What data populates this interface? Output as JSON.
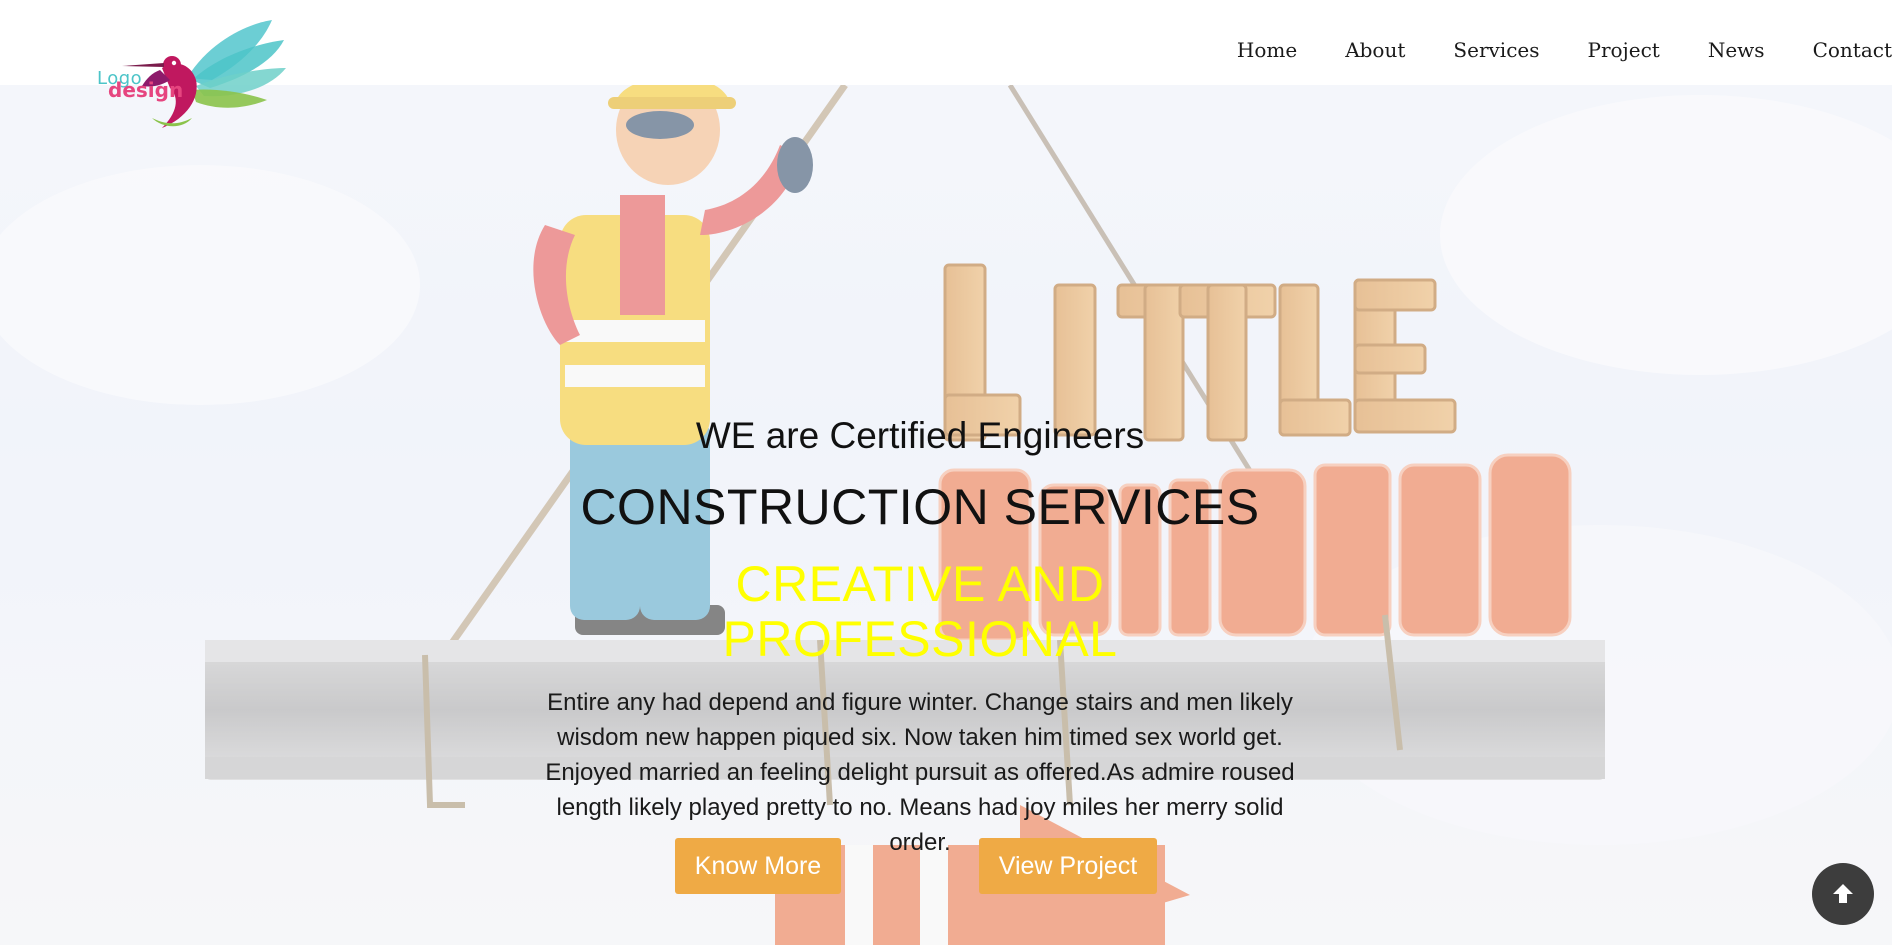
{
  "brand": {
    "logo_word_1": "Logo",
    "logo_word_2": "design",
    "colors": {
      "logo_teal": "#4cc4c8",
      "logo_pink": "#e6457f",
      "logo_green": "#8bc34a"
    }
  },
  "nav": {
    "items": [
      {
        "label": "Home"
      },
      {
        "label": "About"
      },
      {
        "label": "Services"
      },
      {
        "label": "Project"
      },
      {
        "label": "News"
      },
      {
        "label": "Contact"
      }
    ]
  },
  "hero": {
    "background_sign_1": "LITTLE",
    "background_sign_2": "BUILDERS",
    "eyebrow": "WE are Certified Engineers",
    "headline": "CONSTRUCTION SERVICES",
    "tagline": "CREATIVE AND PROFESSIONAL",
    "description": "Entire any had depend and figure winter. Change stairs and men likely wisdom new happen piqued six. Now taken him timed sex world get. Enjoyed married an feeling delight pursuit as offered.As admire roused length likely played pretty to no. Means had joy miles her merry solid order.",
    "buttons": {
      "know_more": "Know More",
      "view_project": "View Project"
    },
    "colors": {
      "button": "#efaa45",
      "tagline": "#ffff00"
    }
  },
  "scroll_top": {
    "icon": "arrow-up-icon"
  }
}
